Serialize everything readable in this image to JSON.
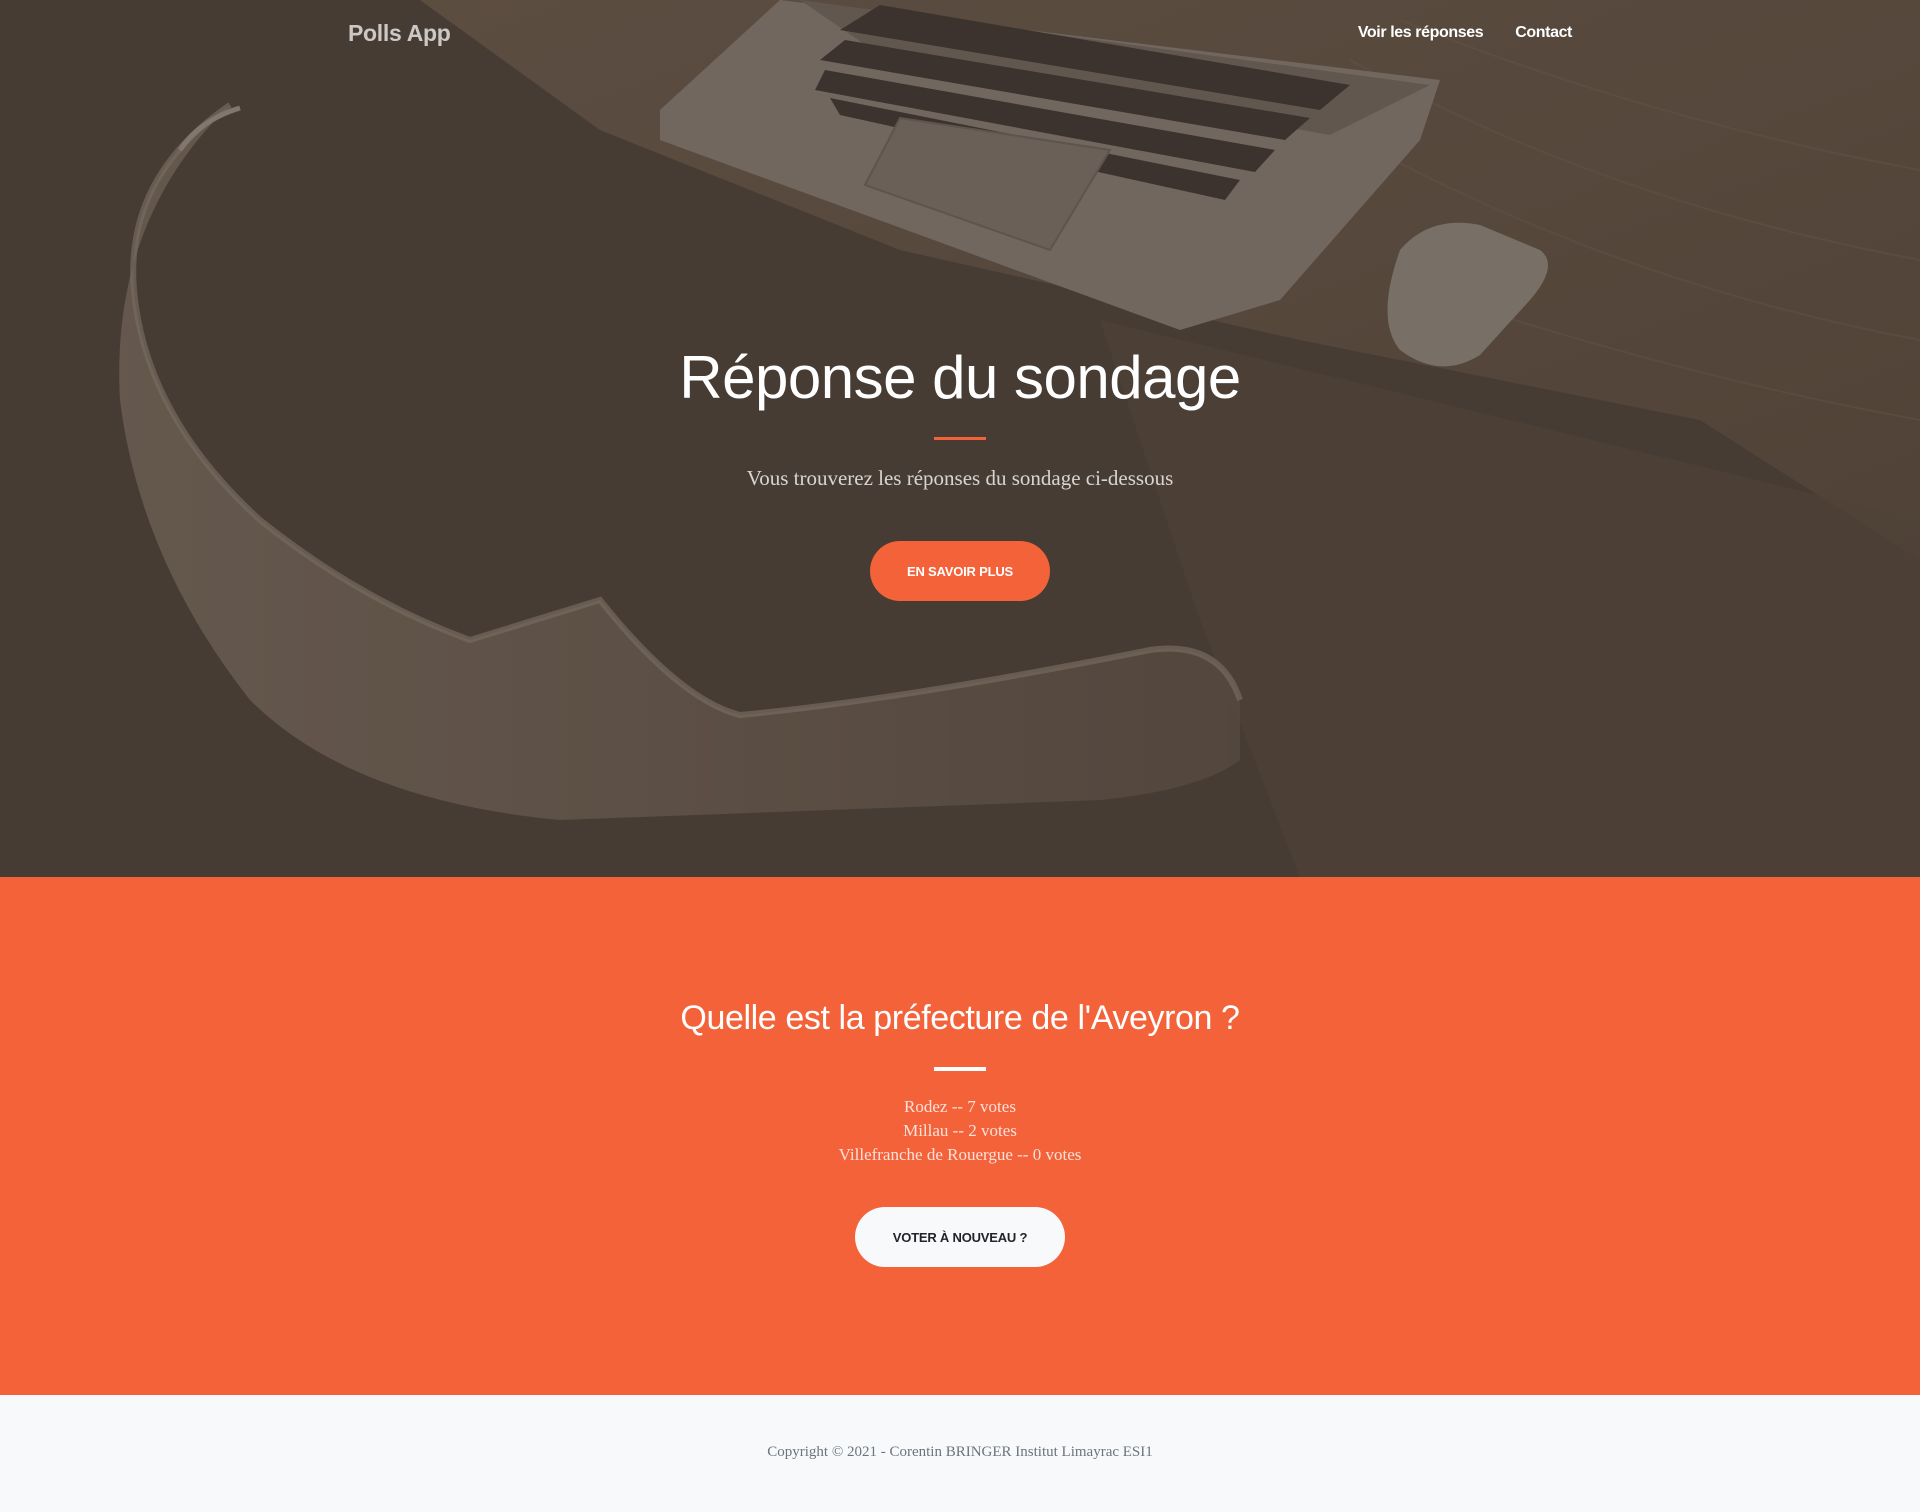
{
  "navbar": {
    "brand": "Polls App",
    "links": [
      {
        "label": "Voir les réponses"
      },
      {
        "label": "Contact"
      }
    ]
  },
  "hero": {
    "title": "Réponse du sondage",
    "subtitle": "Vous trouverez les réponses du sondage ci-dessous",
    "button_label": "EN SAVOIR PLUS"
  },
  "results": {
    "question": "Quelle est la préfecture de l'Aveyron ?",
    "answers": [
      {
        "text": "Rodez -- 7 votes"
      },
      {
        "text": "Millau -- 2 votes"
      },
      {
        "text": "Villefranche de Rouergue -- 0 votes"
      }
    ],
    "button_label": "VOTER À NOUVEAU ?"
  },
  "footer": {
    "copyright": "Copyright © 2021 - Corentin BRINGER Institut Limayrac ESI1"
  },
  "colors": {
    "accent": "#f4623a",
    "hero_overlay": "#4b4038",
    "footer_bg": "#f8f9fa",
    "footer_text": "#6c757d"
  }
}
